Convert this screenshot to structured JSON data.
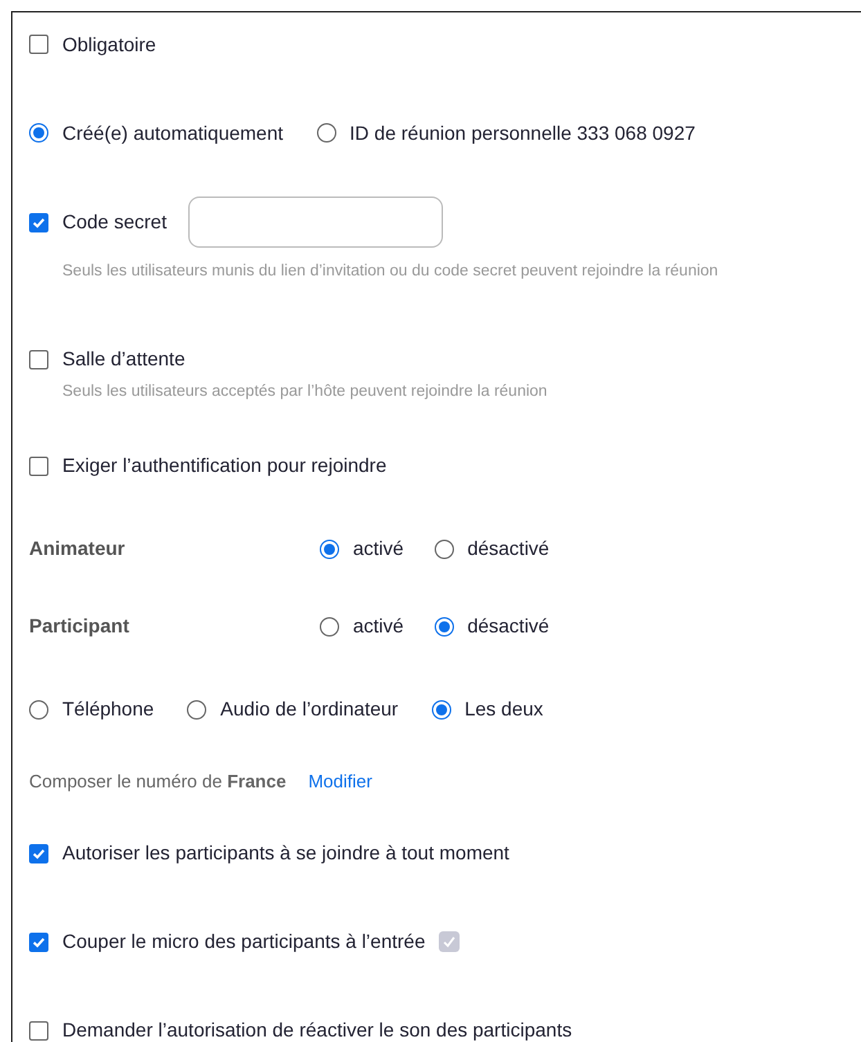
{
  "rows": [
    {
      "kind": "checkbox",
      "label": "Obligatoire",
      "checked": false
    },
    {
      "kind": "radios",
      "options": [
        {
          "label": "Créé(e) automatiquement",
          "selected": true
        },
        {
          "label": "ID de réunion personnelle 333 068 0927",
          "selected": false
        }
      ]
    },
    {
      "kind": "checkbox",
      "label": "Code secret",
      "checked": true,
      "field": true,
      "hint": "Seuls les utilisateurs munis du lien d’invitation ou du code secret peuvent rejoindre la réunion"
    },
    {
      "kind": "checkbox",
      "label": "Salle d’attente",
      "checked": false,
      "hint": "Seuls les utilisateurs acceptés par l’hôte peuvent rejoindre la réunion"
    },
    {
      "kind": "checkbox",
      "label": "Exiger l’authentification pour rejoindre",
      "checked": false
    },
    {
      "kind": "labeled",
      "label": "Animateur",
      "options": [
        {
          "label": "activé",
          "selected": true
        },
        {
          "label": "désactivé",
          "selected": false
        }
      ]
    },
    {
      "kind": "labeled",
      "label": "Participant",
      "options": [
        {
          "label": "activé",
          "selected": false
        },
        {
          "label": "désactivé",
          "selected": true
        }
      ]
    },
    {
      "kind": "radios",
      "options": [
        {
          "label": "Téléphone",
          "selected": false
        },
        {
          "label": "Audio de l’ordinateur",
          "selected": false
        },
        {
          "label": "Les deux",
          "selected": true
        }
      ]
    },
    {
      "kind": "dial",
      "text": "Composer le numéro de **France**",
      "link": "Modifier"
    },
    {
      "kind": "checkbox",
      "label": "Autoriser les participants à se joindre à tout moment",
      "checked": true
    },
    {
      "kind": "checkbox",
      "label": "Couper le micro des participants à l’entrée",
      "checked": true,
      "badge": true
    },
    {
      "kind": "checkbox",
      "label": "Demander l’autorisation de réactiver le son des participants",
      "checked": false
    }
  ]
}
